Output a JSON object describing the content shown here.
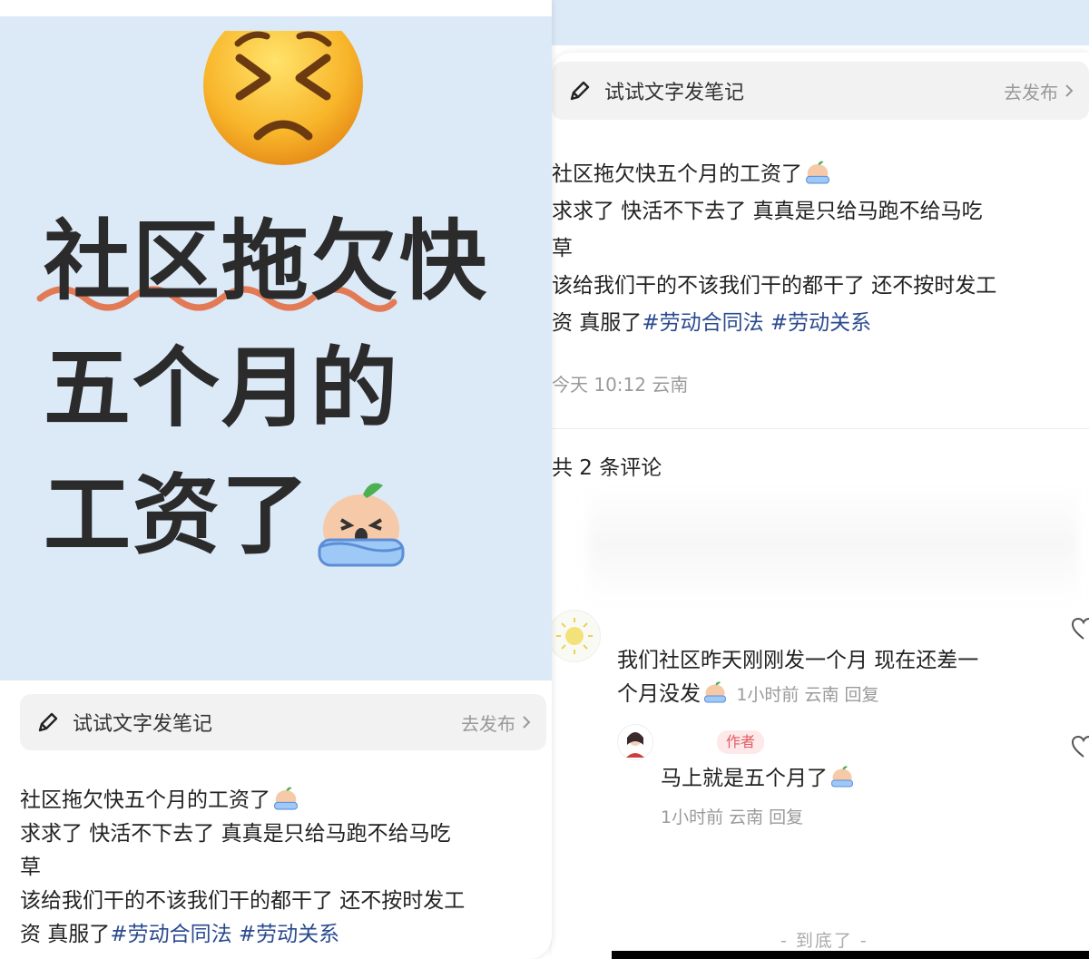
{
  "left": {
    "headline": [
      "社区拖欠快",
      "五个月的",
      "工资了"
    ],
    "note_bar": {
      "label": "试试文字发笔记",
      "action": "去发布"
    },
    "post_lines": [
      "社区拖欠快五个月的工资了",
      "求求了  快活不下去了  真真是只给马跑不给马吃",
      "草",
      "该给我们干的不该我们干的都干了  还不按时发工",
      "资  真服了"
    ],
    "tags": [
      "#劳动合同法",
      "#劳动关系"
    ]
  },
  "right": {
    "note_bar": {
      "label": "试试文字发笔记",
      "action": "去发布"
    },
    "post_lines": [
      "社区拖欠快五个月的工资了",
      "求求了  快活不下去了  真真是只给马跑不给马吃",
      "草",
      "该给我们干的不该我们干的都干了  还不按时发工",
      "资  真服了"
    ],
    "tags": [
      "#劳动合同法",
      "#劳动关系"
    ],
    "post_meta": "今天 10:12 云南",
    "comment_count": "共 2 条评论",
    "comments": [
      {
        "text_line1": "我们社区昨天刚刚发一个月  现在还差一",
        "text_line2": "个月没发",
        "meta": "1小时前 云南 回复"
      },
      {
        "badge": "作者",
        "text": "马上就是五个月了",
        "meta": "1小时前 云南 回复"
      }
    ],
    "end_mark": "- 到底了 -"
  },
  "colors": {
    "cover_bg": "#dce9f7",
    "tag": "#2a4a8f",
    "underline": "#e27a55",
    "badge_text": "#e35b63"
  },
  "icons": [
    "persevering-face-emoji",
    "crying-cartoon-emoji",
    "pencil-icon",
    "chevron-right-icon",
    "heart-icon"
  ]
}
